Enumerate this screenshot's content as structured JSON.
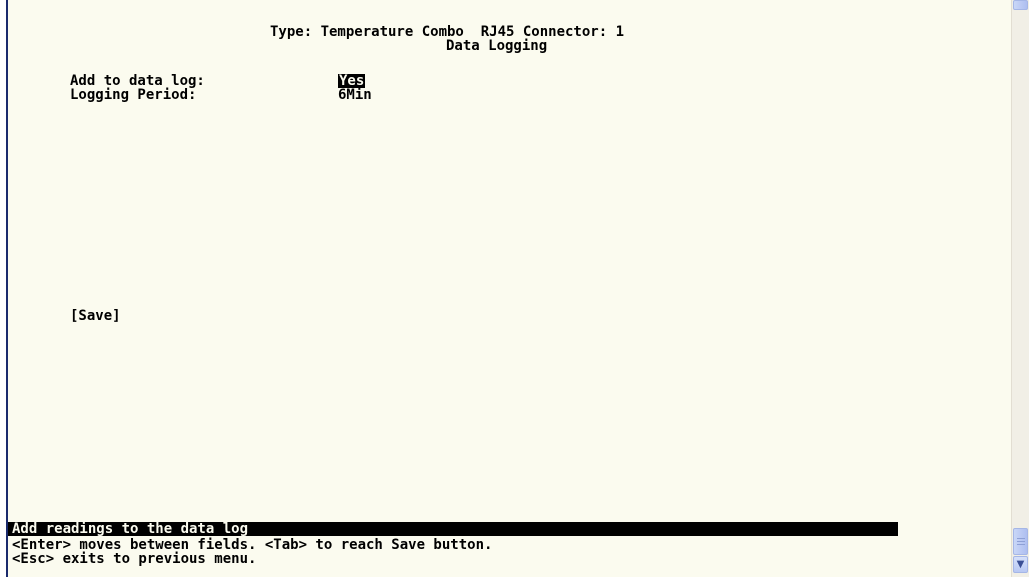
{
  "header": {
    "type_line": "Type: Temperature Combo  RJ45 Connector: 1",
    "title": "Data Logging"
  },
  "fields": [
    {
      "label": "Add to data log:",
      "value": "Yes"
    },
    {
      "label": "Logging Period:",
      "value": "6Min"
    }
  ],
  "buttons": {
    "save_label": "[Save]"
  },
  "status": {
    "message": "Add readings to the data log",
    "help_line_1": "<Enter> moves between fields. <Tab> to reach Save button.",
    "help_line_2": "<Esc> exits to previous menu."
  },
  "scrollbar": {
    "down_arrow_icon": "chevron-down-icon"
  },
  "colors": {
    "terminal_background": "#fbfbef",
    "text": "#000000",
    "highlight_background": "#000000",
    "scrollbar_accent": "#aebef0"
  }
}
